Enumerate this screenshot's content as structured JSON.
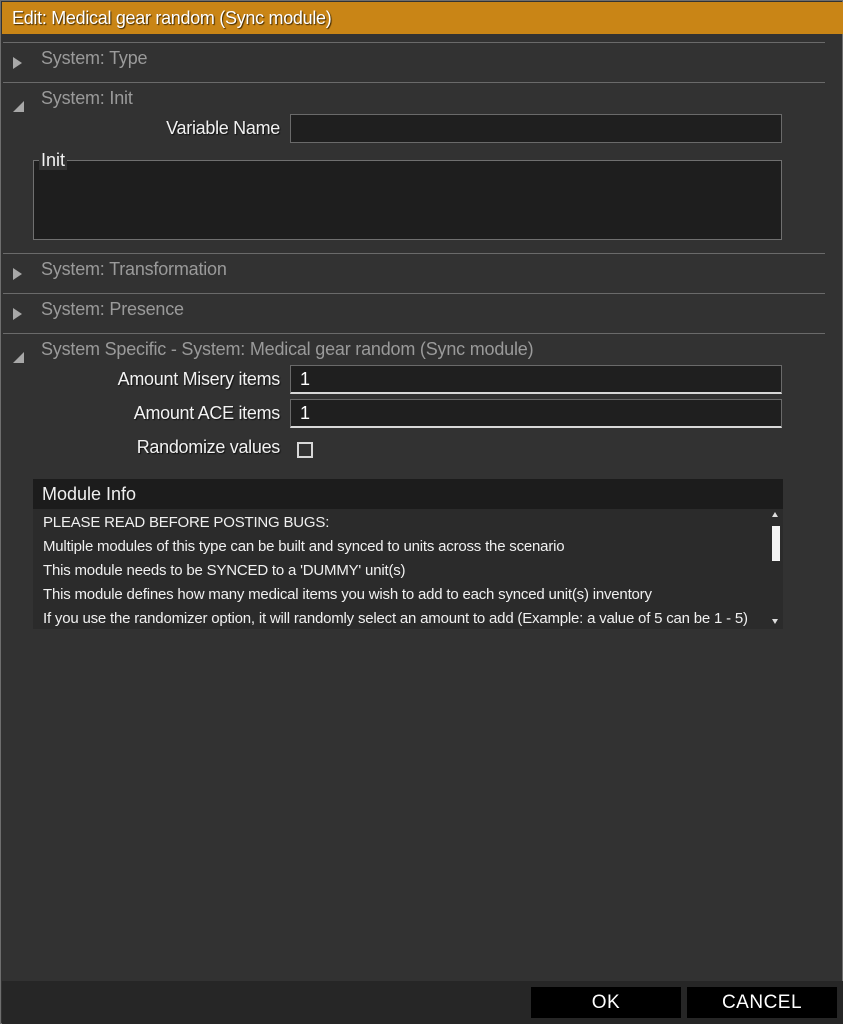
{
  "window": {
    "title": "Edit: Medical gear random (Sync module)",
    "accent_color": "#c98516"
  },
  "sections": {
    "type": {
      "label": "System: Type",
      "expanded": false
    },
    "init": {
      "label": "System: Init",
      "expanded": true
    },
    "transformation": {
      "label": "System: Transformation",
      "expanded": false
    },
    "presence": {
      "label": "System: Presence",
      "expanded": false
    },
    "specific": {
      "label": "System Specific - System: Medical gear random (Sync module)",
      "expanded": true
    }
  },
  "init": {
    "variable_name_label": "Variable Name",
    "variable_name_value": "",
    "init_label": "Init",
    "init_value": ""
  },
  "specific": {
    "misery_label": "Amount Misery items",
    "misery_value": "1",
    "ace_label": "Amount ACE items",
    "ace_value": "1",
    "randomize_label": "Randomize values",
    "randomize_checked": false
  },
  "module_info": {
    "title": "Module Info",
    "lines": [
      "PLEASE READ BEFORE POSTING BUGS:",
      "Multiple modules of this type can be built and synced to units across the scenario",
      "This module needs to be SYNCED to a 'DUMMY' unit(s)",
      "This module defines how many medical items you wish to add to each synced unit(s) inventory",
      "If you use the randomizer option, it will randomly select an amount to add (Example: a value of 5 can be 1 - 5)"
    ]
  },
  "buttons": {
    "ok": "OK",
    "cancel": "CANCEL"
  }
}
